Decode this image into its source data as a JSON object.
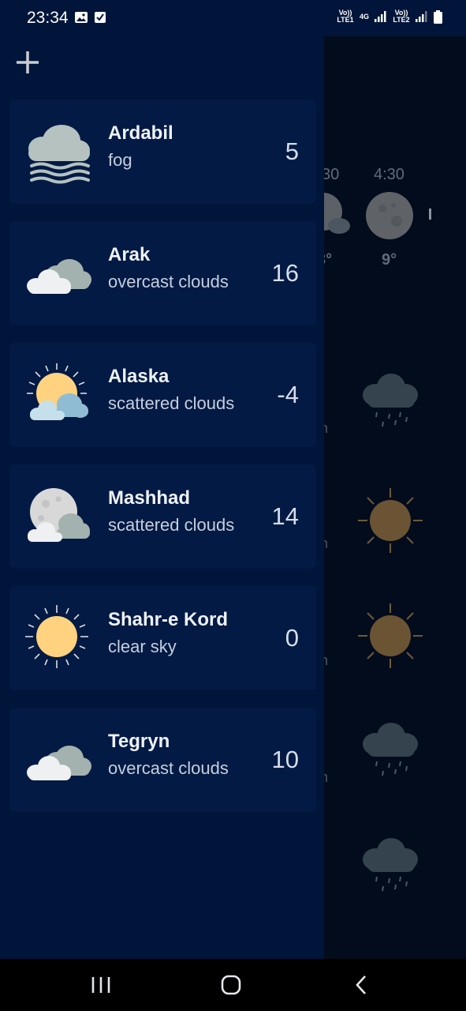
{
  "status_bar": {
    "time": "23:34",
    "sim1_label": "Vo)) LTE1",
    "network_label": "4G",
    "sim2_label": "Vo)) LTE2",
    "icons": [
      "gallery-icon",
      "checkbox-icon",
      "signal-icon",
      "battery-icon"
    ]
  },
  "drawer": {
    "add_icon": "plus-icon",
    "cities": [
      {
        "name": "Ardabil",
        "description": "fog",
        "temp": "5",
        "icon": "fog-icon"
      },
      {
        "name": "Arak",
        "description": "overcast clouds",
        "temp": "16",
        "icon": "overcast-clouds-icon"
      },
      {
        "name": "Alaska",
        "description": "scattered clouds",
        "temp": "-4",
        "icon": "sun-clouds-icon"
      },
      {
        "name": "Mashhad",
        "description": "scattered clouds",
        "temp": "14",
        "icon": "moon-clouds-icon"
      },
      {
        "name": "Shahr-e Kord",
        "description": "clear sky",
        "temp": "0",
        "icon": "sun-icon"
      },
      {
        "name": "Tegryn",
        "description": "overcast clouds",
        "temp": "10",
        "icon": "overcast-clouds-icon"
      }
    ]
  },
  "background": {
    "hours": [
      "30",
      "4:30"
    ],
    "temps": [
      "3°",
      "9°"
    ],
    "letter": "n"
  },
  "nav_bar": {
    "buttons": [
      "recent-apps-icon",
      "home-icon",
      "back-icon"
    ]
  },
  "colors": {
    "drawer_bg": "#00153a",
    "card_bg": "#021a44",
    "sun": "#ffd27f",
    "cloud": "#b5c2c0"
  }
}
